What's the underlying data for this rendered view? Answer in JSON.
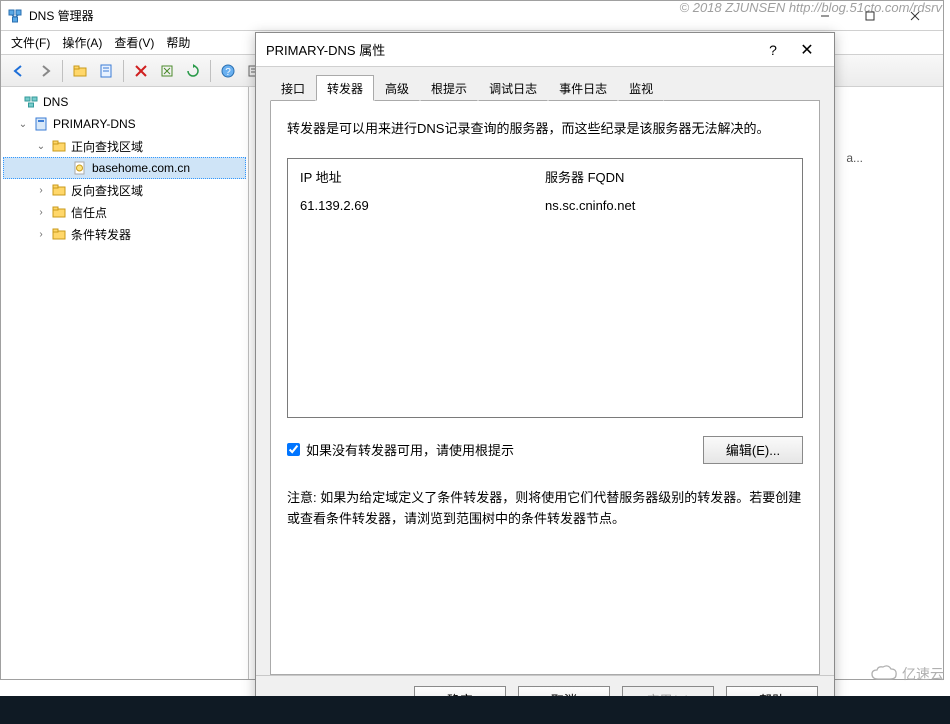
{
  "watermark": "© 2018 ZJUNSEN http://blog.51cto.com/rdsrv",
  "cloud_wm": "亿速云",
  "main": {
    "title": "DNS 管理器",
    "menus": [
      "文件(F)",
      "操作(A)",
      "查看(V)",
      "帮助"
    ],
    "tree": {
      "root": "DNS",
      "server": "PRIMARY-DNS",
      "fwd_zone": "正向查找区域",
      "domain": "basehome.com.cn",
      "rev_zone": "反向查找区域",
      "trust": "信任点",
      "cond": "条件转发器"
    },
    "right_trunc": "a..."
  },
  "dialog": {
    "title": "PRIMARY-DNS 属性",
    "tabs": [
      "接口",
      "转发器",
      "高级",
      "根提示",
      "调试日志",
      "事件日志",
      "监视"
    ],
    "active_tab": 1,
    "desc": "转发器是可以用来进行DNS记录查询的服务器，而这些纪录是该服务器无法解决的。",
    "col1": "IP 地址",
    "col2": "服务器 FQDN",
    "rows": [
      {
        "ip": "61.139.2.69",
        "fqdn": "ns.sc.cninfo.net"
      }
    ],
    "use_root_hint": "如果没有转发器可用，请使用根提示",
    "edit_btn": "编辑(E)...",
    "note": "注意: 如果为给定域定义了条件转发器，则将使用它们代替服务器级别的转发器。若要创建或查看条件转发器，请浏览到范围树中的条件转发器节点。",
    "buttons": {
      "ok": "确定",
      "cancel": "取消",
      "apply": "应用(A)",
      "help": "帮助"
    }
  }
}
